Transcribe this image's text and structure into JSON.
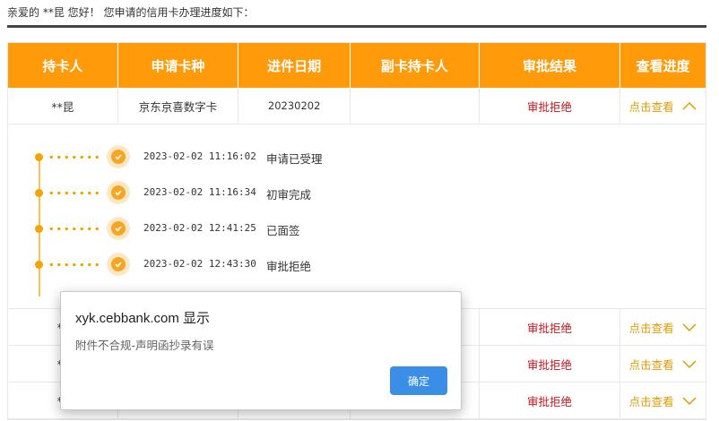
{
  "greeting": "亲爱的 **昆 您好！ 您申请的信用卡办理进度如下：",
  "table": {
    "headers": [
      "持卡人",
      "申请卡种",
      "进件日期",
      "副卡持卡人",
      "审批结果",
      "查看进度"
    ],
    "first_row": {
      "holder": "**昆",
      "card_type": "京东京喜数字卡",
      "date": "20230202",
      "secondary": "",
      "result": "审批拒绝",
      "view": "点击查看"
    },
    "timeline": [
      {
        "time": "2023-02-02 11:16:02",
        "status": "申请已受理"
      },
      {
        "time": "2023-02-02 11:16:34",
        "status": "初审完成"
      },
      {
        "time": "2023-02-02 12:41:25",
        "status": "已面签"
      },
      {
        "time": "2023-02-02 12:43:30",
        "status": "审批拒绝"
      }
    ],
    "other_rows": [
      {
        "holder": "**",
        "result": "审批拒绝",
        "view": "点击查看"
      },
      {
        "holder": "**",
        "result": "审批拒绝",
        "view": "点击查看"
      },
      {
        "holder": "**",
        "result": "审批拒绝",
        "view": "点击查看"
      }
    ]
  },
  "dialog": {
    "title": "xyk.cebbank.com 显示",
    "message": "附件不合规-声明函抄录有误",
    "ok": "确定"
  },
  "colors": {
    "header": "#ff9b0a",
    "reject": "#c8161d",
    "link": "#e09a00",
    "button": "#3a8ee6"
  }
}
